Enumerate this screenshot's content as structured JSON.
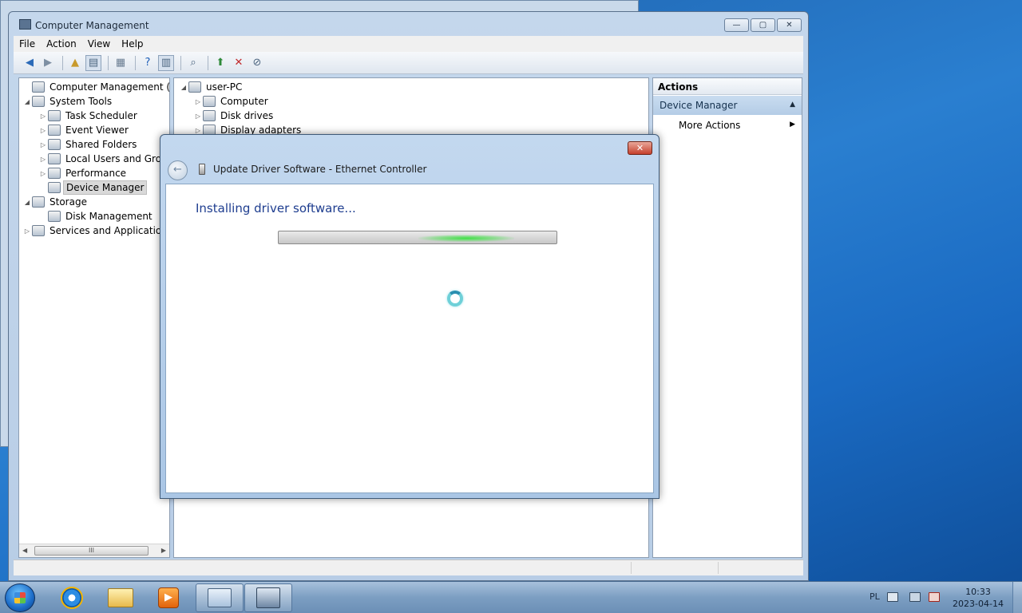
{
  "window": {
    "title": "Computer Management",
    "controls": {
      "minimize": "—",
      "maximize": "▢",
      "close": "✕"
    }
  },
  "menu": [
    "File",
    "Action",
    "View",
    "Help"
  ],
  "tree": {
    "items": [
      {
        "label": "Computer Management (Local",
        "level": 0,
        "arrow": "",
        "icon": "computer-management-icon"
      },
      {
        "label": "System Tools",
        "level": 1,
        "arrow": "◢",
        "icon": "tools-icon"
      },
      {
        "label": "Task Scheduler",
        "level": 2,
        "arrow": "▷",
        "icon": "clock-icon"
      },
      {
        "label": "Event Viewer",
        "level": 2,
        "arrow": "▷",
        "icon": "event-viewer-icon"
      },
      {
        "label": "Shared Folders",
        "level": 2,
        "arrow": "▷",
        "icon": "shared-folder-icon"
      },
      {
        "label": "Local Users and Group",
        "level": 2,
        "arrow": "▷",
        "icon": "users-icon"
      },
      {
        "label": "Performance",
        "level": 2,
        "arrow": "▷",
        "icon": "performance-icon"
      },
      {
        "label": "Device Manager",
        "level": 2,
        "arrow": "",
        "icon": "device-manager-icon",
        "selected": true
      },
      {
        "label": "Storage",
        "level": 1,
        "arrow": "◢",
        "icon": "storage-icon"
      },
      {
        "label": "Disk Management",
        "level": 2,
        "arrow": "",
        "icon": "disk-icon"
      },
      {
        "label": "Services and Applications",
        "level": 1,
        "arrow": "▷",
        "icon": "services-icon"
      }
    ],
    "scroll_thumb": "III"
  },
  "devices": {
    "root": "user-PC",
    "items": [
      "Computer",
      "Disk drives",
      "Display adapters"
    ]
  },
  "actions": {
    "header": "Actions",
    "section": "Device Manager",
    "more": "More Actions"
  },
  "dialog": {
    "title": "Update Driver Software - Ethernet Controller",
    "heading": "Installing driver software...",
    "close_glyph": "✕",
    "back_glyph": "←"
  },
  "taskbar": {
    "language": "PL",
    "time": "10:33",
    "date": "2023-04-14"
  }
}
